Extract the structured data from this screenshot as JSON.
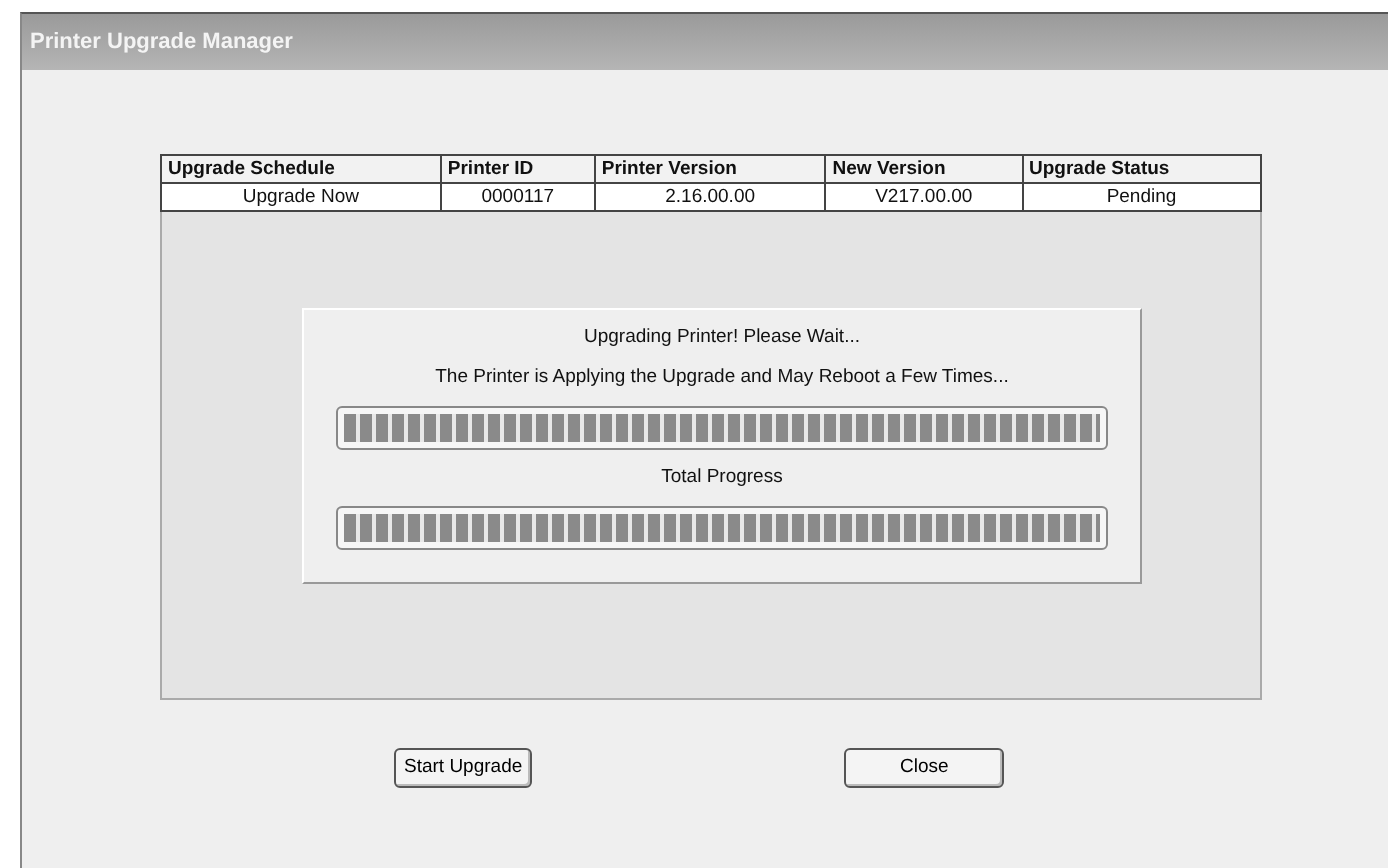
{
  "window": {
    "title": "Printer Upgrade Manager"
  },
  "table": {
    "columns": [
      "Upgrade Schedule",
      "Printer ID",
      "Printer Version",
      "New Version",
      "Upgrade Status"
    ],
    "rows": [
      [
        "Upgrade Now",
        "0000117",
        "2.16.00.00",
        "V217.00.00",
        "Pending"
      ]
    ]
  },
  "progress_dialog": {
    "message": "Upgrading Printer! Please Wait...",
    "detail": "The Printer is Applying the Upgrade and May Reboot a Few Times...",
    "bars": [
      {
        "level": 1
      },
      {
        "label": "Total Progress",
        "level": 1
      }
    ]
  },
  "buttons": [
    "Start Upgrade",
    "Close"
  ]
}
